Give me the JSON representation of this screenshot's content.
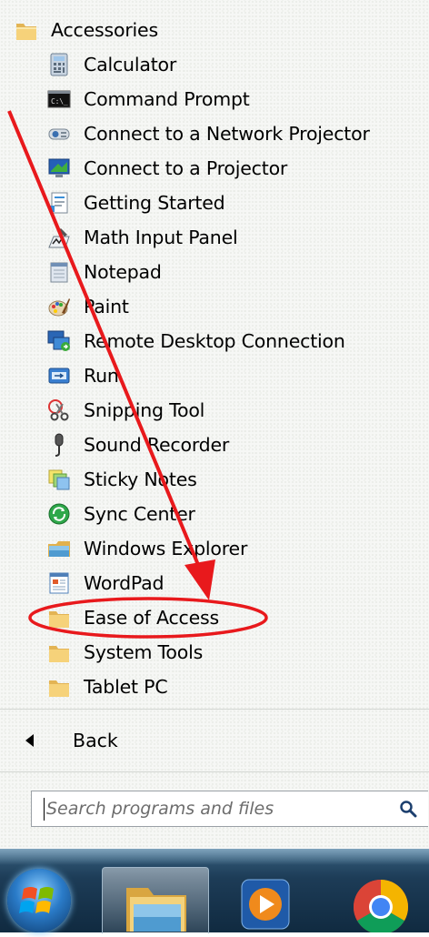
{
  "menu": {
    "folder_title": "Accessories",
    "items": [
      {
        "label": "Calculator",
        "icon": "calculator-icon"
      },
      {
        "label": "Command Prompt",
        "icon": "command-prompt-icon"
      },
      {
        "label": "Connect to a Network Projector",
        "icon": "network-projector-icon"
      },
      {
        "label": "Connect to a Projector",
        "icon": "projector-icon"
      },
      {
        "label": "Getting Started",
        "icon": "getting-started-icon"
      },
      {
        "label": "Math Input Panel",
        "icon": "math-input-icon"
      },
      {
        "label": "Notepad",
        "icon": "notepad-icon"
      },
      {
        "label": "Paint",
        "icon": "paint-icon"
      },
      {
        "label": "Remote Desktop Connection",
        "icon": "remote-desktop-icon"
      },
      {
        "label": "Run",
        "icon": "run-icon"
      },
      {
        "label": "Snipping Tool",
        "icon": "snipping-tool-icon"
      },
      {
        "label": "Sound Recorder",
        "icon": "microphone-icon"
      },
      {
        "label": "Sticky Notes",
        "icon": "sticky-notes-icon"
      },
      {
        "label": "Sync Center",
        "icon": "sync-center-icon"
      },
      {
        "label": "Windows Explorer",
        "icon": "windows-explorer-icon"
      },
      {
        "label": "WordPad",
        "icon": "wordpad-icon"
      }
    ],
    "subfolders": [
      {
        "label": "Ease of Access",
        "icon": "folder-icon"
      },
      {
        "label": "System Tools",
        "icon": "folder-icon"
      },
      {
        "label": "Tablet PC",
        "icon": "folder-icon"
      }
    ],
    "back_label": "Back"
  },
  "search": {
    "placeholder": "Search programs and files"
  },
  "taskbar": {
    "items": [
      "start-orb",
      "windows-explorer-icon",
      "media-player-icon",
      "chrome-icon"
    ]
  },
  "colors": {
    "annotation_red": "#e8191c",
    "taskbar": "#1d3c57",
    "menu_bg": "#f6f7f5"
  }
}
